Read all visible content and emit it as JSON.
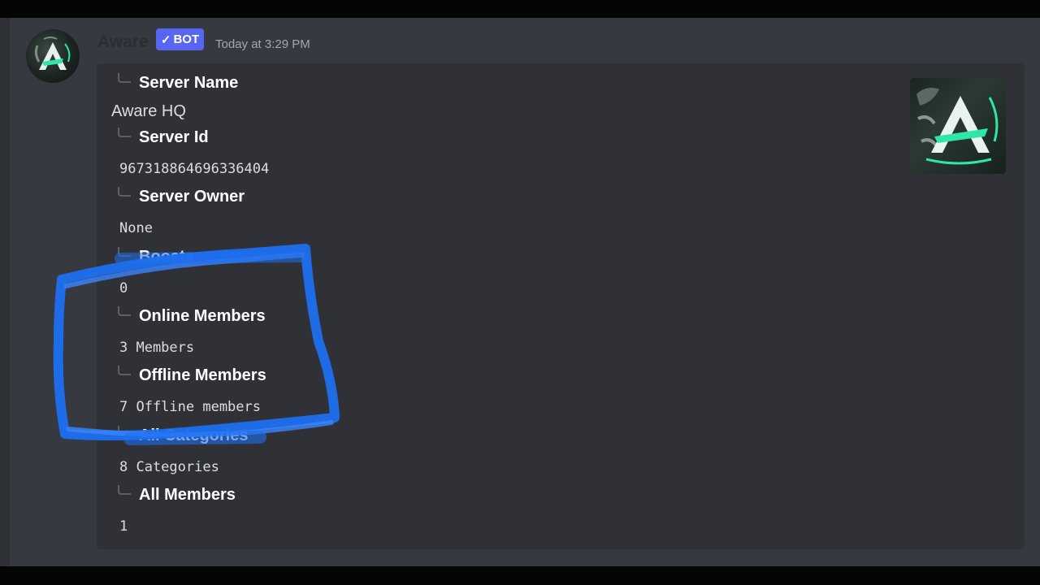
{
  "message": {
    "author": "Aware",
    "badge": "BOT",
    "badge_check": "✓",
    "timestamp": "Today at 3:29 PM",
    "avatar_icon": "aware-logo-icon",
    "thumbnail_icon": "aware-server-icon"
  },
  "embed": {
    "fields": [
      {
        "name": "Server Name",
        "value": "Aware HQ"
      },
      {
        "name": "Server Id",
        "value": "967318864696336404"
      },
      {
        "name": "Server Owner",
        "value": "None"
      },
      {
        "name": "Boosts",
        "value": "0"
      },
      {
        "name": "Online Members",
        "value": "3 Members"
      },
      {
        "name": "Offline Members",
        "value": "7 Offline members"
      },
      {
        "name": "All Categories",
        "value": "8 Categories"
      },
      {
        "name": "All Members",
        "value": "1"
      }
    ]
  },
  "colors": {
    "background": "#36393f",
    "embed": "#2f3136",
    "bot_badge": "#5865f2",
    "annotation": "#1e6ff0",
    "accent_green": "#2ee6a8"
  }
}
